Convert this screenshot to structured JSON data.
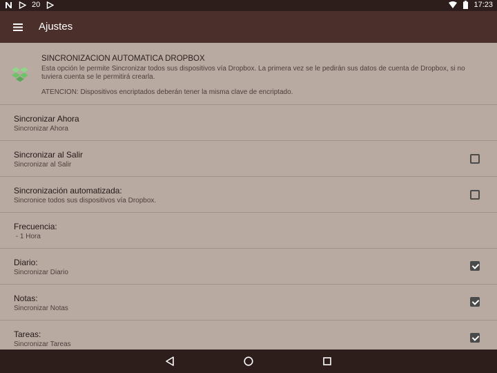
{
  "status_bar": {
    "notification_count": "20",
    "time": "17:23"
  },
  "app_bar": {
    "title": "Ajustes"
  },
  "dropbox_section": {
    "title": "SINCRONIZACION AUTOMATICA DROPBOX",
    "description": "Esta opción le permite Sincronizar todos sus dispositivos vía Dropbox. La primera vez se le pedirán sus datos de cuenta de Dropbox, si no tuviera cuenta se le permitirá crearla.",
    "warning": "ATENCION: Dispositivos encriptados deberán tener la misma clave de encriptado."
  },
  "settings": [
    {
      "title": "Sincronizar Ahora",
      "subtitle": "Sincronizar Ahora",
      "checkbox": null
    },
    {
      "title": "Sincronizar al Salir",
      "subtitle": "Sincronizar al Salir",
      "checkbox": false
    },
    {
      "title": "Sincronización automatizada:",
      "subtitle": "Sincronice todos sus dispositivos vía Dropbox.",
      "checkbox": false
    },
    {
      "title": "Frecuencia:",
      "subtitle": " - 1 Hora",
      "checkbox": null
    },
    {
      "title": "Diario:",
      "subtitle": "Sincronizar Diario",
      "checkbox": true
    },
    {
      "title": "Notas:",
      "subtitle": "Sincronizar Notas",
      "checkbox": true
    },
    {
      "title": "Tareas:",
      "subtitle": "Sincronizar Tareas",
      "checkbox": true
    }
  ],
  "icons": {
    "menu": "hamburger-menu-icon",
    "dropbox": "dropbox-icon",
    "back": "back-triangle-icon",
    "home": "home-circle-icon",
    "recents": "recents-square-icon"
  },
  "colors": {
    "status_bar": "#2e1e1b",
    "app_bar": "#4b2f2a",
    "background": "#b8a9a1",
    "divider": "#9f9089",
    "checkbox": "#4a4a4a",
    "dropbox_icon": "#6ec26a"
  }
}
